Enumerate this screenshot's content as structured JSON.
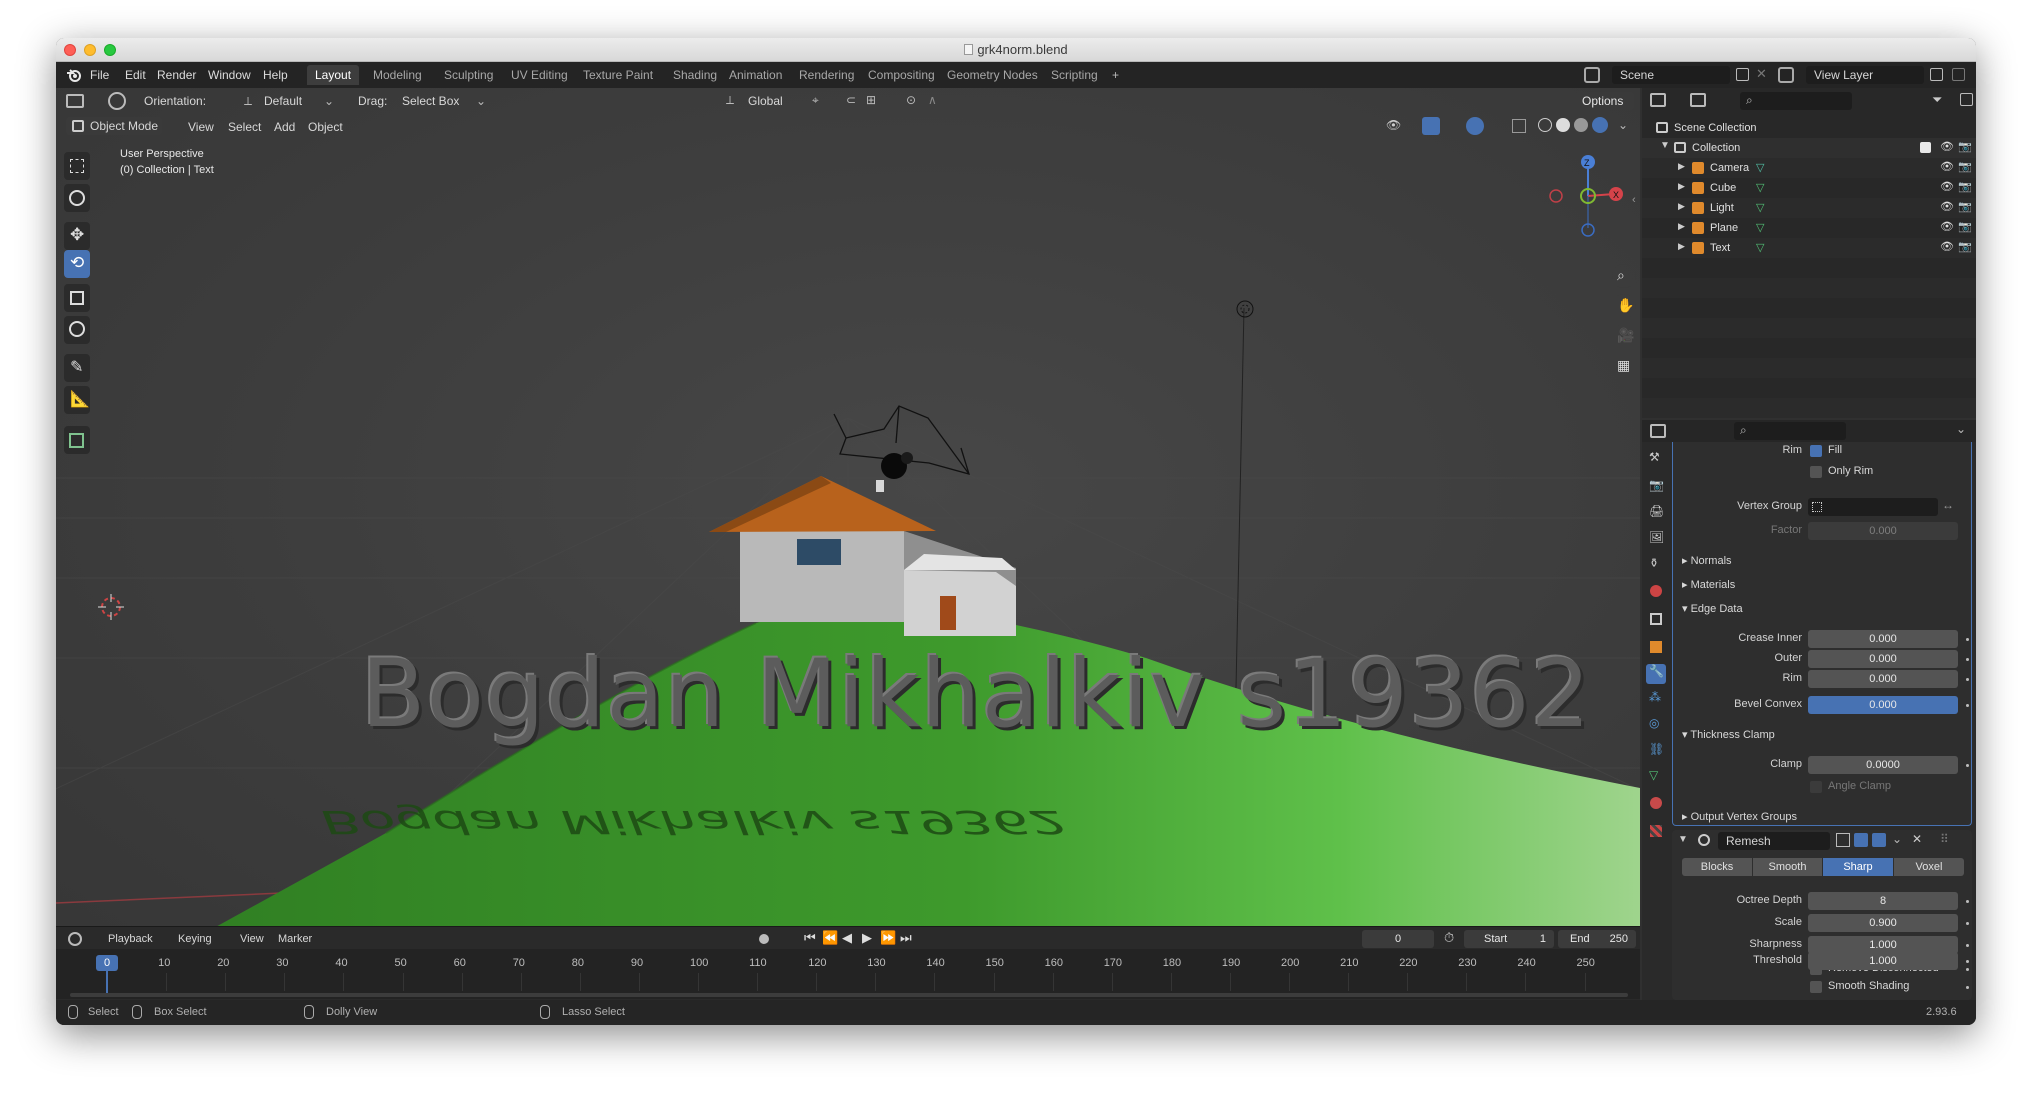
{
  "window": {
    "title": "grk4norm.blend"
  },
  "menus": [
    "File",
    "Edit",
    "Render",
    "Window",
    "Help"
  ],
  "workspaces": [
    "Layout",
    "Modeling",
    "Sculpting",
    "UV Editing",
    "Texture Paint",
    "Shading",
    "Animation",
    "Rendering",
    "Compositing",
    "Geometry Nodes",
    "Scripting"
  ],
  "active_workspace": "Layout",
  "scene": {
    "name": "Scene",
    "view_layer": "View Layer"
  },
  "tool_header": {
    "orientation_label": "Orientation:",
    "orientation_value": "Default",
    "drag_label": "Drag:",
    "drag_value": "Select Box",
    "transform": "Global",
    "options": "Options"
  },
  "viewport_header": {
    "mode": "Object Mode",
    "menus": [
      "View",
      "Select",
      "Add",
      "Object"
    ]
  },
  "viewport": {
    "perspective": "User Perspective",
    "collection": "(0) Collection | Text",
    "text_object": "Bogdan Mikhalkiv s19362",
    "colors": {
      "ground": "#3e9a2c",
      "roof": "#b8621c",
      "walls": "#c9c9c9",
      "window": "#2d4b66",
      "door": "#a04a1a"
    },
    "gizmo_axes": [
      "X",
      "Y",
      "Z"
    ]
  },
  "outliner": {
    "root": "Scene Collection",
    "collection": "Collection",
    "objects": [
      {
        "name": "Camera",
        "icon": "camera-icon"
      },
      {
        "name": "Cube",
        "icon": "mesh-icon"
      },
      {
        "name": "Light",
        "icon": "light-icon"
      },
      {
        "name": "Plane",
        "icon": "mesh-icon"
      },
      {
        "name": "Text",
        "icon": "text-icon"
      }
    ]
  },
  "properties": {
    "rim_label": "Rim",
    "fill_label": "Fill",
    "only_rim_label": "Only Rim",
    "vertex_group_label": "Vertex Group",
    "factor_label": "Factor",
    "factor_value": "0.000",
    "normals": "Normals",
    "materials": "Materials",
    "edge_data": "Edge Data",
    "crease_inner_label": "Crease Inner",
    "crease_inner_value": "0.000",
    "outer_label": "Outer",
    "outer_value": "0.000",
    "rim2_label": "Rim",
    "rim2_value": "0.000",
    "bevel_convex_label": "Bevel Convex",
    "bevel_convex_value": "0.000",
    "thickness_clamp": "Thickness Clamp",
    "clamp_label": "Clamp",
    "clamp_value": "0.0000",
    "angle_clamp_label": "Angle Clamp",
    "output_vertex_groups": "Output Vertex Groups",
    "remesh_name": "Remesh",
    "remesh_modes": [
      "Blocks",
      "Smooth",
      "Sharp",
      "Voxel"
    ],
    "remesh_active": "Sharp",
    "octree_label": "Octree Depth",
    "octree_value": "8",
    "scale_label": "Scale",
    "scale_value": "0.900",
    "sharpness_label": "Sharpness",
    "sharpness_value": "1.000",
    "remove_disconnected_label": "Remove Disconnected",
    "threshold_label": "Threshold",
    "threshold_value": "1.000",
    "smooth_shading_label": "Smooth Shading"
  },
  "timeline": {
    "menus": [
      "Playback",
      "Keying",
      "View",
      "Marker"
    ],
    "current_frame": "0",
    "start_label": "Start",
    "start_value": "1",
    "end_label": "End",
    "end_value": "250",
    "ticks": [
      "0",
      "10",
      "20",
      "30",
      "40",
      "50",
      "60",
      "70",
      "80",
      "90",
      "100",
      "110",
      "120",
      "130",
      "140",
      "150",
      "160",
      "170",
      "180",
      "190",
      "200",
      "210",
      "220",
      "230",
      "240",
      "250"
    ]
  },
  "statusbar": {
    "select": "Select",
    "box_select": "Box Select",
    "dolly_view": "Dolly View",
    "lasso_select": "Lasso Select",
    "version": "2.93.6"
  }
}
